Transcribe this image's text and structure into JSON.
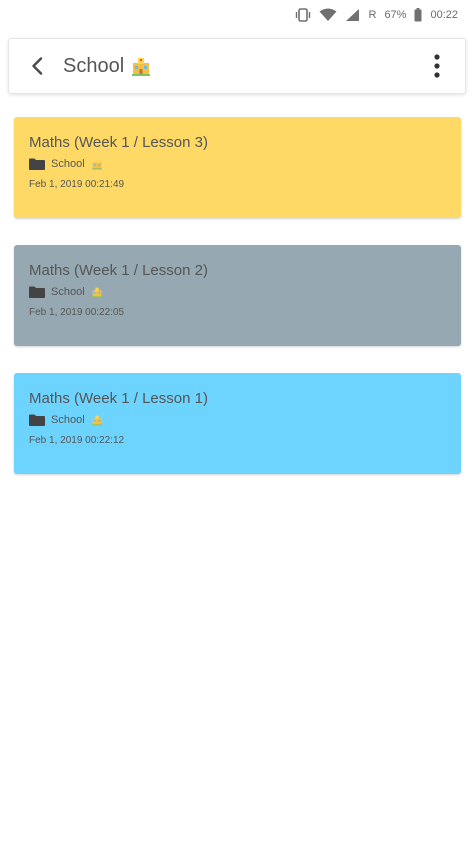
{
  "status_bar": {
    "battery_percent": "67%",
    "time": "00:22",
    "roaming": "R"
  },
  "app_bar": {
    "title": "School",
    "back_icon": "arrow-back-icon",
    "more_icon": "more-vertical-icon",
    "title_icon": "school-building-icon"
  },
  "notes": [
    {
      "title": "Maths (Week 1 / Lesson 3)",
      "folder": "School",
      "date": "Feb 1, 2019 00:21:49",
      "color": "#FFD966"
    },
    {
      "title": "Maths (Week 1 / Lesson 2)",
      "folder": "School",
      "date": "Feb 1, 2019 00:22:05",
      "color": "#96A9B3"
    },
    {
      "title": "Maths (Week 1 / Lesson 1)",
      "folder": "School",
      "date": "Feb 1, 2019 00:22:12",
      "color": "#6DD3FF"
    }
  ]
}
